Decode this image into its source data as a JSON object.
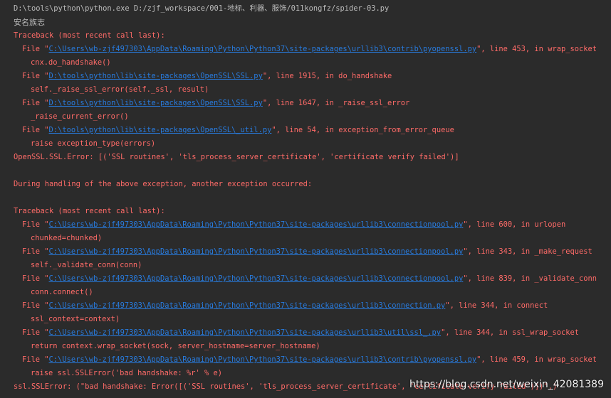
{
  "command": "D:\\tools\\python\\python.exe D:/zjf_workspace/001-地标、利器、服饰/011kongfz/spider-03.py",
  "output_text": "安名族志",
  "traceback_header": "Traceback (most recent call last):",
  "file_word": "File ",
  "first_traceback": [
    {
      "path": "C:\\Users\\wb-zjf497303\\AppData\\Roaming\\Python\\Python37\\site-packages\\urllib3\\contrib\\pyopenssl.py",
      "rest": ", line 453, in wrap_socket",
      "code": "cnx.do_handshake()"
    },
    {
      "path": "D:\\tools\\python\\lib\\site-packages\\OpenSSL\\SSL.py",
      "rest": ", line 1915, in do_handshake",
      "code": "self._raise_ssl_error(self._ssl, result)"
    },
    {
      "path": "D:\\tools\\python\\lib\\site-packages\\OpenSSL\\SSL.py",
      "rest": ", line 1647, in _raise_ssl_error",
      "code": "_raise_current_error()"
    },
    {
      "path": "D:\\tools\\python\\lib\\site-packages\\OpenSSL\\_util.py",
      "rest": ", line 54, in exception_from_error_queue",
      "code": "raise exception_type(errors)"
    }
  ],
  "first_error": "OpenSSL.SSL.Error: [('SSL routines', 'tls_process_server_certificate', 'certificate verify failed')]",
  "during_message": "During handling of the above exception, another exception occurred:",
  "second_traceback": [
    {
      "path": "C:\\Users\\wb-zjf497303\\AppData\\Roaming\\Python\\Python37\\site-packages\\urllib3\\connectionpool.py",
      "rest": ", line 600, in urlopen",
      "code": "chunked=chunked)"
    },
    {
      "path": "C:\\Users\\wb-zjf497303\\AppData\\Roaming\\Python\\Python37\\site-packages\\urllib3\\connectionpool.py",
      "rest": ", line 343, in _make_request",
      "code": "self._validate_conn(conn)"
    },
    {
      "path": "C:\\Users\\wb-zjf497303\\AppData\\Roaming\\Python\\Python37\\site-packages\\urllib3\\connectionpool.py",
      "rest": ", line 839, in _validate_conn",
      "code": "conn.connect()"
    },
    {
      "path": "C:\\Users\\wb-zjf497303\\AppData\\Roaming\\Python\\Python37\\site-packages\\urllib3\\connection.py",
      "rest": ", line 344, in connect",
      "code": "ssl_context=context)"
    },
    {
      "path": "C:\\Users\\wb-zjf497303\\AppData\\Roaming\\Python\\Python37\\site-packages\\urllib3\\util\\ssl_.py",
      "rest": ", line 344, in ssl_wrap_socket",
      "code": "return context.wrap_socket(sock, server_hostname=server_hostname)"
    },
    {
      "path": "C:\\Users\\wb-zjf497303\\AppData\\Roaming\\Python\\Python37\\site-packages\\urllib3\\contrib\\pyopenssl.py",
      "rest": ", line 459, in wrap_socket",
      "code": "raise ssl.SSLError('bad handshake: %r' % e)"
    }
  ],
  "final_error": "ssl.SSLError: (\"bad handshake: Error([('SSL routines', 'tls_process_server_certificate', 'certificate verify failed')])\",)",
  "watermark": "https://blog.csdn.net/weixin_42081389",
  "colors": {
    "background": "#2b2b2b",
    "text": "#bbbbbb",
    "error": "#ff6b68",
    "link": "#287bde"
  }
}
